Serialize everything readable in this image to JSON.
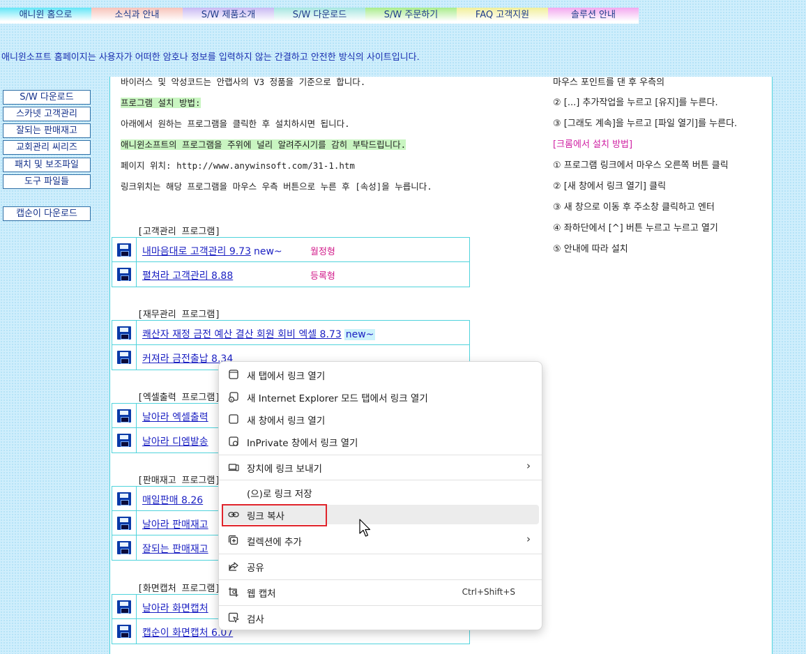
{
  "nav": {
    "tabs": [
      {
        "label": "애니윈 홈으로",
        "color": "#63e6f7"
      },
      {
        "label": "소식과 안내",
        "color": "#f7c3ba"
      },
      {
        "label": "S/W 제품소개",
        "color": "#c9b9f3"
      },
      {
        "label": "S/W 다운로드",
        "color": "#a6e6e0"
      },
      {
        "label": "S/W 주문하기",
        "color": "#a9ec8b"
      },
      {
        "label": "FAQ 고객지원",
        "color": "#f1ef9a"
      },
      {
        "label": "솔루션 안내",
        "color": "#f3a8ef"
      }
    ]
  },
  "notice": "애니윈소프트 홈페이지는 사용자가 어떠한 암호나 정보를 입력하지 않는 간결하고 안전한 방식의 사이트입니다.",
  "sidebar": {
    "items": [
      "S/W 다운로드",
      "스카넷 고객관리",
      "잘되는 판매재고",
      "교회관리 씨리즈",
      "패치 및 보조파일",
      "도구 파일들"
    ],
    "extra": "캡순이 다운로드"
  },
  "content": {
    "lines": [
      "바이러스 및 악성코드는 안랩사의 V3 정품을 기준으로 합니다.",
      "프로그램 설치 방법:",
      "아래에서 원하는 프로그램을 클릭한 후 설치하시면 됩니다.",
      "애니윈소프트의 프로그램을 주위에 널리 알려주시기를 감히 부탁드립니다.",
      "페이지 위치: http://www.anywinsoft.com/31-1.htm",
      "링크위치는 해당 프로그램을 마우스 우측 버튼으로 누른 후 [속성]을 누릅니다."
    ],
    "right_lines": [
      "마우스 포인트를 댄 후 우측의",
      "② [...] 추가작업을 누르고 [유지]를 누른다.",
      "③ [그래도 계속]을 누르고 [파일 열기]를 누른다.",
      "[크롬에서 설치 방법]",
      "① 프로그램 링크에서 마우스 오른쪽 버튼 클릭",
      "② [새 창에서 링크 열기] 클릭",
      "③ 새 창으로 이동 후 주소창 클릭하고 엔터",
      "④ 좌하단에서 [^] 버튼 누르고 누르고 열기",
      "⑤ 안내에 따라 설치"
    ],
    "sections": [
      {
        "title": "[고객관리 프로그램]",
        "items": [
          {
            "name": "내마음대로 고객관리 9.73",
            "new": "new~",
            "type": "월정형"
          },
          {
            "name": "펼쳐라 고객관리 8.88",
            "new": "",
            "type": "등록형"
          }
        ]
      },
      {
        "title": "[재무관리 프로그램]",
        "items": [
          {
            "name": "쾌산자 재정 금전 예산 결산 회원 회비 엑셀 8.73",
            "new": "new~",
            "type": ""
          },
          {
            "name": "커져라 금전출납 8.34",
            "new": "",
            "type": ""
          }
        ]
      },
      {
        "title": "[엑셀출력 프로그램]",
        "items": [
          {
            "name": "날아라 엑셀출력",
            "new": "",
            "type": ""
          },
          {
            "name": "날아라 디엠발송",
            "new": "",
            "type": ""
          }
        ]
      },
      {
        "title": "[판매재고 프로그램]",
        "items": [
          {
            "name": "매일판매 8.26",
            "new": "",
            "type": ""
          },
          {
            "name": "날아라 판매재고",
            "new": "",
            "type": ""
          },
          {
            "name": "잘되는 판매재고",
            "new": "",
            "type": ""
          }
        ]
      },
      {
        "title": "[화면캡처 프로그램]",
        "items": [
          {
            "name": "날아라 화면캡처",
            "new": "",
            "type": ""
          },
          {
            "name": "캡순이 화면캡처 6.07",
            "new": "",
            "type": ""
          }
        ]
      }
    ]
  },
  "context_menu": {
    "items": [
      {
        "label": "새 탭에서 링크 열기",
        "icon": "new-tab-icon"
      },
      {
        "label": "새 Internet Explorer 모드 탭에서 링크 열기",
        "icon": "ie-mode-icon"
      },
      {
        "label": "새 창에서 링크 열기",
        "icon": "new-window-icon"
      },
      {
        "label": "InPrivate 창에서 링크 열기",
        "icon": "inprivate-icon"
      },
      {
        "label": "장치에 링크 보내기",
        "icon": "send-to-device-icon",
        "submenu": "›"
      },
      {
        "label": "(으)로 링크 저장",
        "icon": ""
      },
      {
        "label": "링크 복사",
        "icon": "link-icon"
      },
      {
        "label": "컬렉션에 추가",
        "icon": "collections-icon",
        "submenu": "›"
      },
      {
        "label": "공유",
        "icon": "share-icon"
      },
      {
        "label": "웹 캡처",
        "icon": "web-capture-icon",
        "shortcut": "Ctrl+Shift+S"
      },
      {
        "label": "검사",
        "icon": "inspect-icon"
      }
    ]
  }
}
